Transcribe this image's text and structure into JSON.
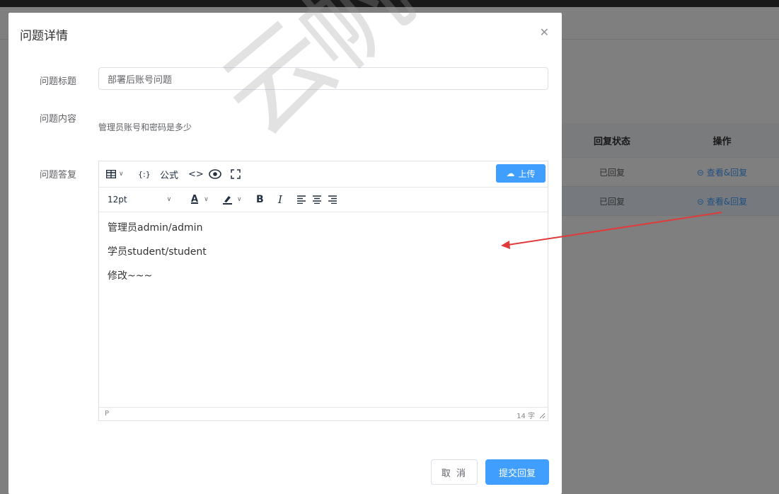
{
  "background": {
    "table": {
      "headers": [
        "回复状态",
        "操作"
      ],
      "rows": [
        {
          "status": "已回复",
          "action": "查看&回复"
        },
        {
          "status": "已回复",
          "action": "查看&回复"
        }
      ]
    }
  },
  "dialog": {
    "title": "问题详情",
    "close_icon": "close-icon",
    "fields": {
      "title_label": "问题标题",
      "title_value": "部署后账号问题",
      "content_label": "问题内容",
      "content_value": "管理员账号和密码是多少",
      "reply_label": "问题答复"
    },
    "editor": {
      "toolbar1": {
        "table": "table-icon",
        "template": "{:}",
        "formula": "公式",
        "code": "<>",
        "preview": "eye-icon",
        "fullscreen": "fullscreen-icon",
        "upload": "上传"
      },
      "toolbar2": {
        "font_size": "12pt",
        "font_color": "A",
        "bold": "B",
        "italic": "I"
      },
      "lines": [
        "管理员admin/admin",
        "学员student/student",
        "修改~~~"
      ],
      "status_path": "P",
      "word_count": "14 字"
    },
    "buttons": {
      "cancel": "取 消",
      "submit": "提交回复"
    }
  },
  "watermark": "云帆"
}
